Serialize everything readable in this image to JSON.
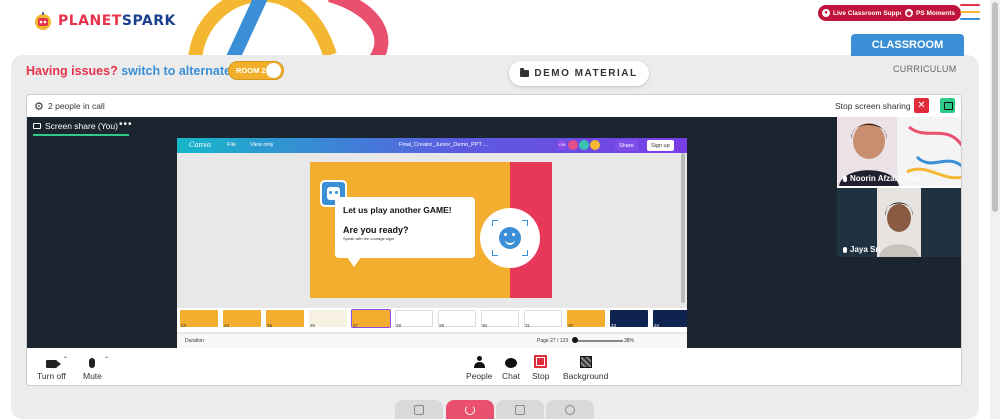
{
  "brand": {
    "logo_text_a": "PLANET",
    "logo_text_b": "SPARK"
  },
  "top_actions": {
    "live_support": "Live Classroom Support",
    "ps_moments": "PS Moments"
  },
  "issues": {
    "prefix": "Having issues?",
    "link": "switch to alternate room",
    "room_label": "ROOM 2"
  },
  "demo_material": "DEMO MATERIAL",
  "tabs": {
    "classroom": "CLASSROOM",
    "curriculum": "CURRICULUM"
  },
  "call": {
    "people_count": "2 people in call",
    "stop_sharing": "Stop screen sharing",
    "screen_share_tab": "Screen share (You)",
    "more": "•••"
  },
  "canva": {
    "logo": "Canva",
    "file": "File",
    "view_only": "View only",
    "doc_title": "Final_Creator_Junior_Demo_PPT ...",
    "extra_count": "+26",
    "share": "Share",
    "sign_up": "Sign up",
    "slide": {
      "question": "Let us play another GAME!",
      "ready": "Are you ready?",
      "subtitle": "Speak with the courage sign!"
    },
    "thumb_numbers": [
      "23",
      "24",
      "25",
      "26",
      "27",
      "28",
      "29",
      "30",
      "31",
      "32",
      "33",
      "34"
    ],
    "footer": {
      "duration": "Duration",
      "page": "Page 27 / 123",
      "zoom": "38%"
    }
  },
  "participants": [
    {
      "name": "Noorin Afzal (You)"
    },
    {
      "name": "Jaya Sri"
    }
  ],
  "controls": {
    "turn_off": "Turn off",
    "mute": "Mute",
    "people": "People",
    "chat": "Chat",
    "stop": "Stop",
    "background": "Background"
  },
  "colors": {
    "brand_red": "#e5334b",
    "brand_blue": "#3a8fd6",
    "stop_red": "#e22b3a",
    "share_green": "#2fc98a"
  }
}
